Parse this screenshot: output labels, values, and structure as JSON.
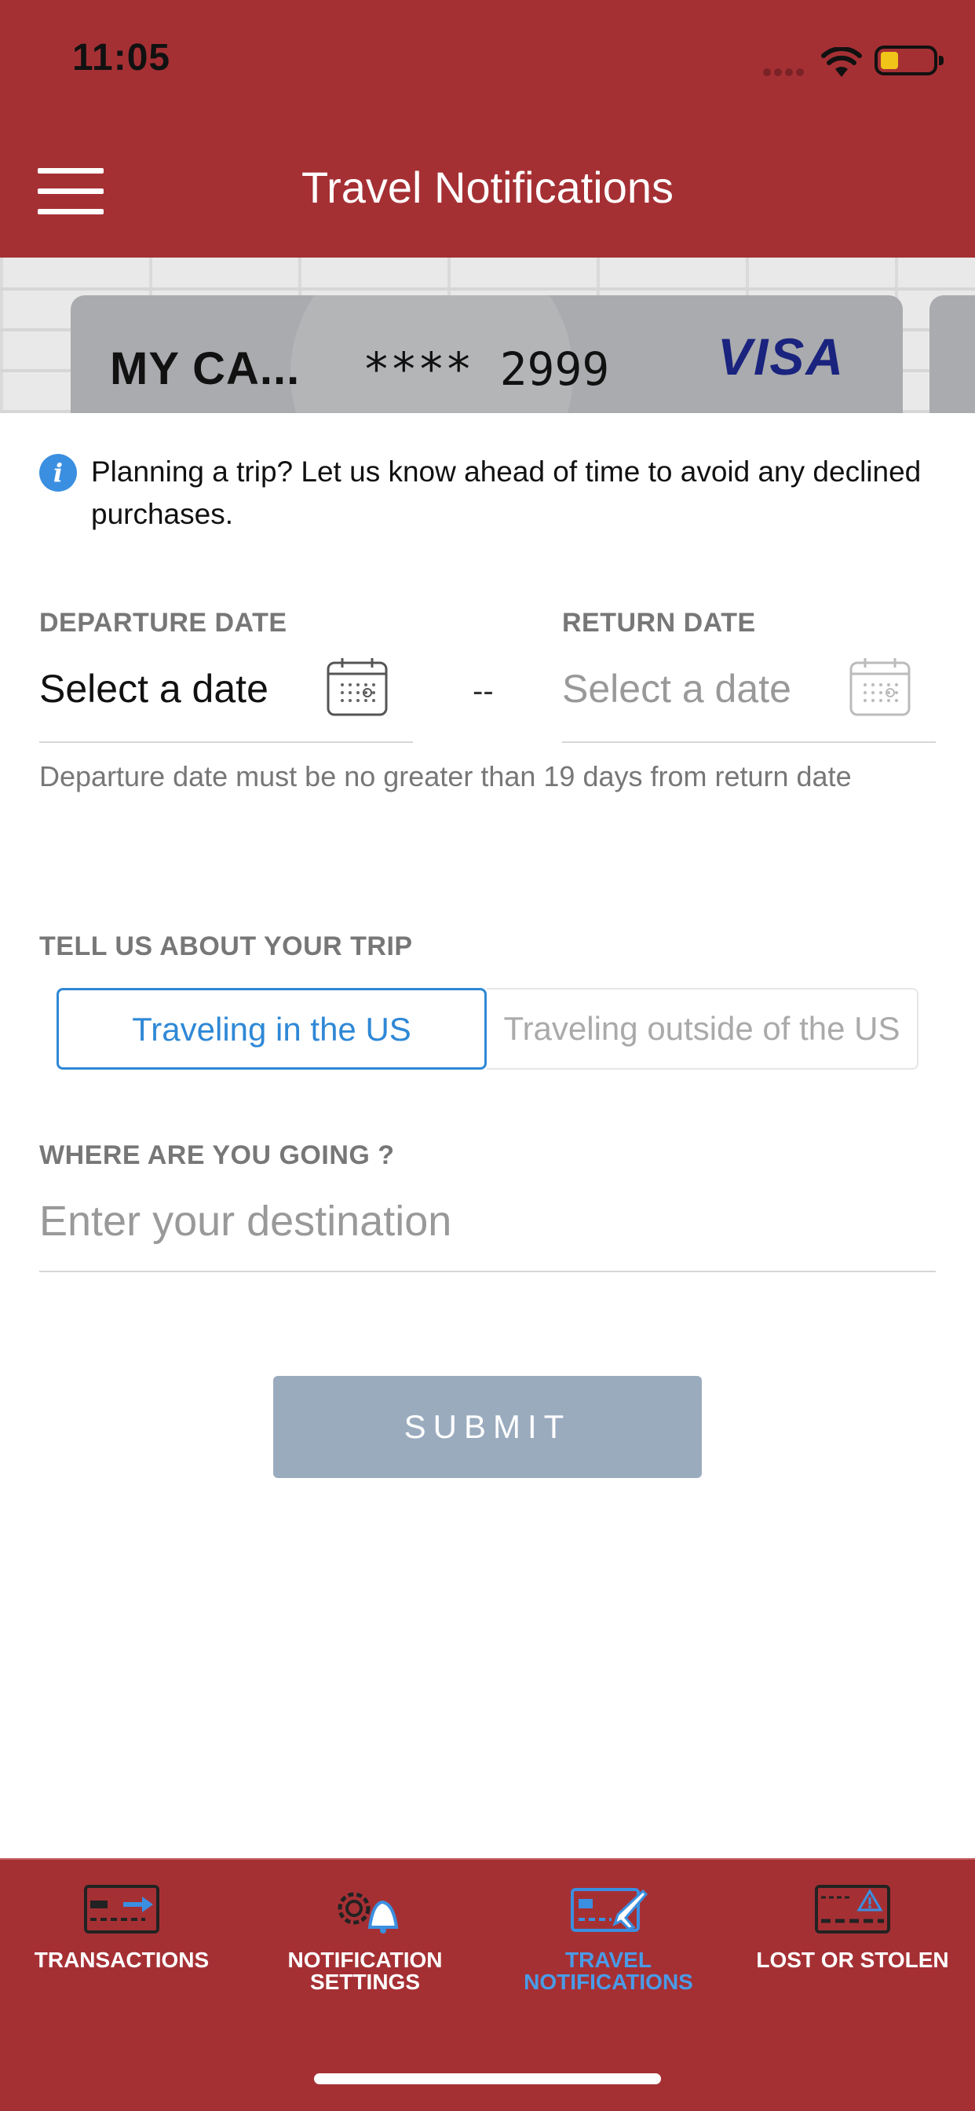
{
  "status_bar": {
    "time": "11:05"
  },
  "header": {
    "title": "Travel Notifications"
  },
  "card": {
    "name": "MY CA...",
    "number_mask": "****",
    "last4": "2999",
    "brand": "VISA",
    "card_color": "#a9abae"
  },
  "info": {
    "text": "Planning a trip? Let us know ahead of time to avoid any declined purchases."
  },
  "dates": {
    "departure_label": "DEPARTURE DATE",
    "departure_value": "Select a date",
    "separator": "--",
    "return_label": "RETURN DATE",
    "return_value": "Select a date",
    "helper": "Departure date must be no greater than 19 days from return date"
  },
  "trip": {
    "label": "TELL US ABOUT YOUR TRIP",
    "options": [
      "Traveling in the US",
      "Traveling outside of the US"
    ],
    "selected": "Traveling in the US"
  },
  "destination": {
    "label": "WHERE ARE YOU GOING ?",
    "placeholder": "Enter your destination",
    "value": ""
  },
  "submit_label": "SUBMIT",
  "tabs": [
    {
      "label": "TRANSACTIONS",
      "icon": "card-transfer-icon",
      "active": false
    },
    {
      "label": "NOTIFICATION\nSETTINGS",
      "icon": "gear-bell-icon",
      "active": false
    },
    {
      "label": "TRAVEL\nNOTIFICATIONS",
      "icon": "card-plane-icon",
      "active": true
    },
    {
      "label": "LOST OR STOLEN",
      "icon": "card-alert-icon",
      "active": false
    }
  ],
  "colors": {
    "brand_red": "#a53034",
    "accent_blue": "#2f88d6",
    "submit_disabled": "#9aabbe"
  }
}
